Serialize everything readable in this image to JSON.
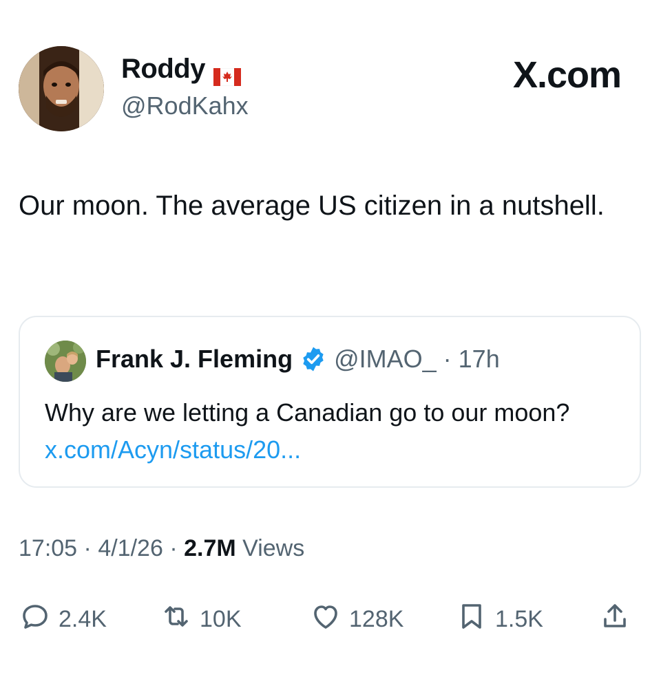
{
  "author": {
    "display_name": "Roddy",
    "handle": "@RodKahx",
    "flag_icon": "canada-flag-icon"
  },
  "site_logo": "X.com",
  "tweet": {
    "text": "Our moon. The average US citizen in a nutshell."
  },
  "quoted_tweet": {
    "display_name": "Frank J. Fleming",
    "verified_icon": "verified-badge-icon",
    "handle": "@IMAO_",
    "separator": "·",
    "time": "17h",
    "text": "Why are we letting a Canadian go to our moon?",
    "link": "x.com/Acyn/status/20..."
  },
  "meta": {
    "time": "17:05",
    "separator": "·",
    "date": "4/1/26",
    "views_count": "2.7M",
    "views_label": "Views"
  },
  "actions": {
    "replies": "2.4K",
    "reposts": "10K",
    "likes": "128K",
    "bookmarks": "1.5K"
  },
  "colors": {
    "text_primary": "#0f1419",
    "text_secondary": "#536471",
    "link": "#1d9bf0",
    "border": "#e6ebef",
    "verified": "#1d9bf0",
    "flag_red": "#d52b1e"
  }
}
